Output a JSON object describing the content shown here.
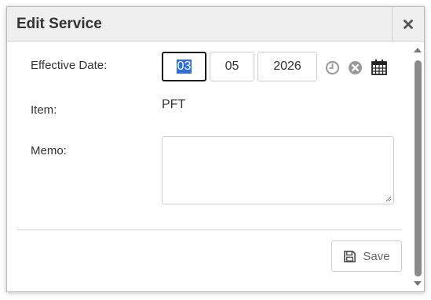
{
  "dialog": {
    "title": "Edit Service",
    "close_icon": "close-icon"
  },
  "form": {
    "effective_date_label": "Effective Date:",
    "date": {
      "month": "03",
      "day": "05",
      "year": "2026"
    },
    "icons": [
      "clock-icon",
      "clear-icon",
      "calendar-icon"
    ],
    "item_label": "Item:",
    "item_value": "PFT",
    "memo_label": "Memo:",
    "memo_value": ""
  },
  "footer": {
    "save_label": "Save",
    "save_icon": "floppy-disk-icon"
  },
  "colors": {
    "selection": "#2f6fd6",
    "title_bar": "#efefef",
    "icon_gray": "#9a9a9a",
    "text": "#333333"
  }
}
